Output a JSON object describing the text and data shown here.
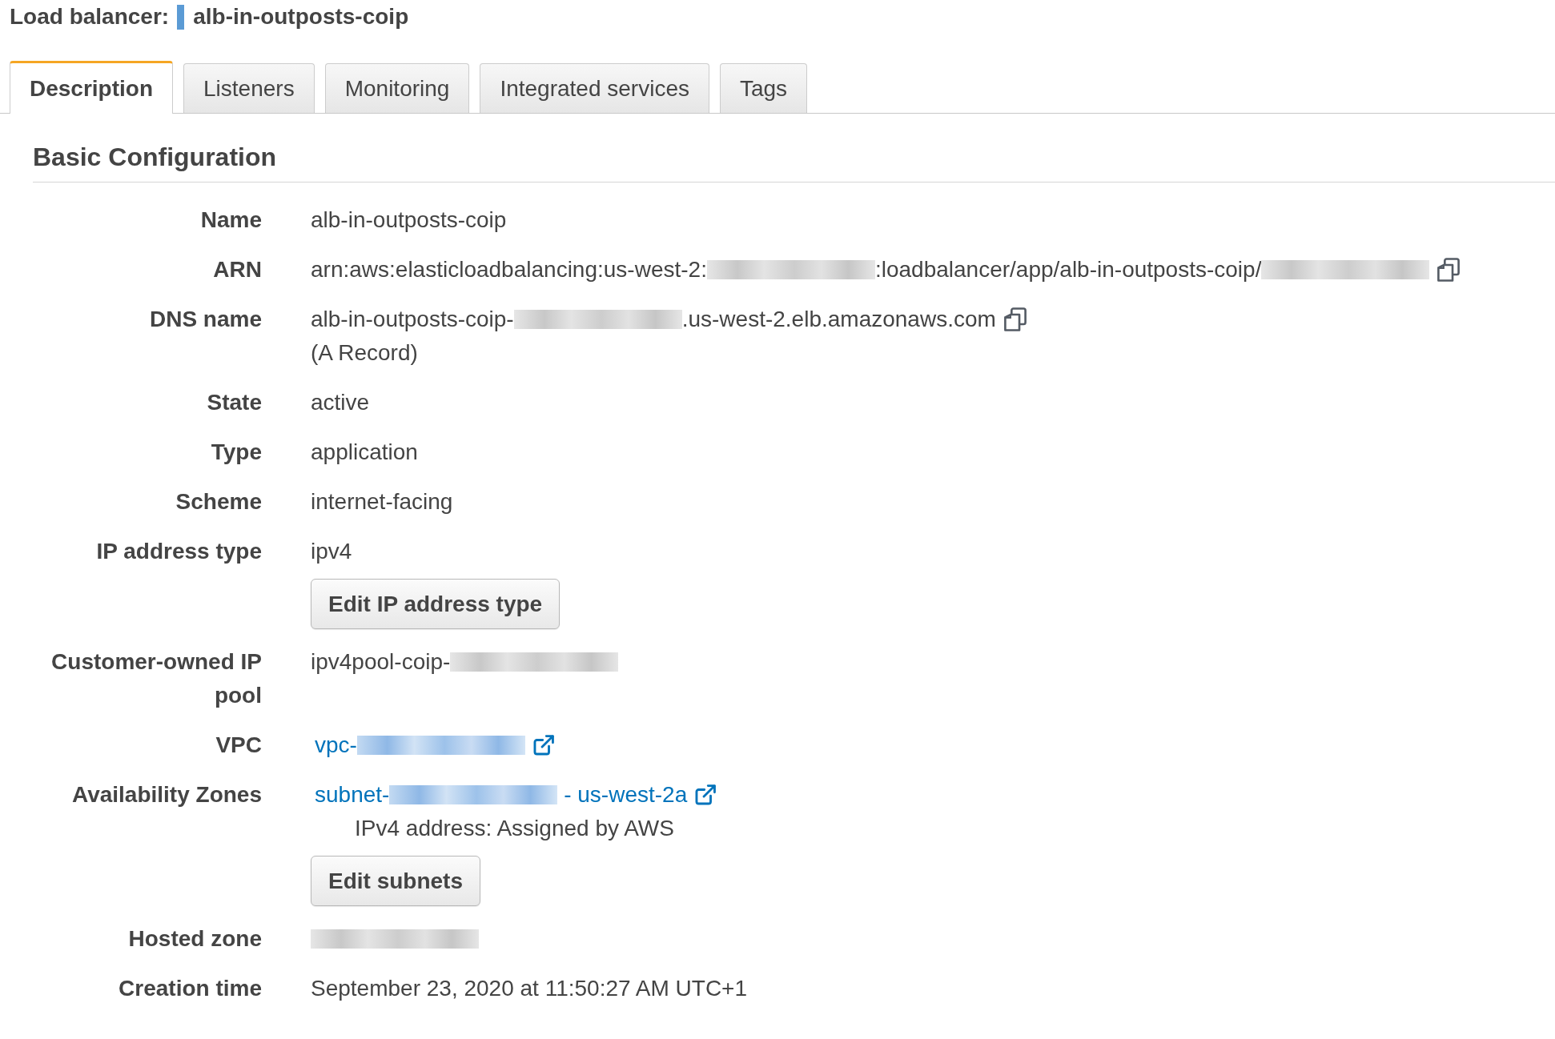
{
  "header": {
    "label": "Load balancer:",
    "name": "alb-in-outposts-coip"
  },
  "tabs": [
    {
      "label": "Description",
      "selected": true
    },
    {
      "label": "Listeners",
      "selected": false
    },
    {
      "label": "Monitoring",
      "selected": false
    },
    {
      "label": "Integrated services",
      "selected": false
    },
    {
      "label": "Tags",
      "selected": false
    }
  ],
  "section": {
    "title": "Basic Configuration",
    "fields": [
      {
        "label": "Name",
        "lines": [
          {
            "kind": "text",
            "parts": [
              {
                "kind": "text",
                "text": "alb-in-outposts-coip"
              }
            ]
          }
        ]
      },
      {
        "label": "ARN",
        "lines": [
          {
            "kind": "text",
            "parts": [
              {
                "kind": "text",
                "text": "arn:aws:elasticloadbalancing:us-west-2:"
              },
              {
                "kind": "redacted"
              },
              {
                "kind": "text",
                "text": ":loadbalancer/app/alb-in-outposts-coip/"
              },
              {
                "kind": "redacted"
              },
              {
                "kind": "copy"
              }
            ]
          }
        ]
      },
      {
        "label": "DNS name",
        "lines": [
          {
            "kind": "text",
            "parts": [
              {
                "kind": "text",
                "text": "alb-in-outposts-coip-"
              },
              {
                "kind": "redacted"
              },
              {
                "kind": "text",
                "text": ".us-west-2.elb.amazonaws.com"
              },
              {
                "kind": "copy"
              }
            ]
          },
          {
            "kind": "text",
            "parts": [
              {
                "kind": "text",
                "text": "(A Record)"
              }
            ]
          }
        ]
      },
      {
        "label": "State",
        "lines": [
          {
            "kind": "text",
            "parts": [
              {
                "kind": "text",
                "text": "active"
              }
            ]
          }
        ]
      },
      {
        "label": "Type",
        "lines": [
          {
            "kind": "text",
            "parts": [
              {
                "kind": "text",
                "text": "application"
              }
            ]
          }
        ]
      },
      {
        "label": "Scheme",
        "lines": [
          {
            "kind": "text",
            "parts": [
              {
                "kind": "text",
                "text": "internet-facing"
              }
            ]
          }
        ]
      },
      {
        "label": "IP address type",
        "lines": [
          {
            "kind": "text",
            "parts": [
              {
                "kind": "text",
                "text": "ipv4"
              }
            ]
          },
          {
            "kind": "button",
            "label": "Edit IP address type"
          }
        ]
      },
      {
        "label": "Customer-owned IP pool",
        "lines": [
          {
            "kind": "text",
            "parts": [
              {
                "kind": "text",
                "text": "ipv4pool-coip-"
              },
              {
                "kind": "redacted"
              }
            ]
          }
        ]
      },
      {
        "label": "VPC",
        "lines": [
          {
            "kind": "link",
            "parts": [
              {
                "kind": "text",
                "text": "vpc-"
              },
              {
                "kind": "redacted"
              },
              {
                "kind": "external"
              }
            ]
          }
        ]
      },
      {
        "label": "Availability Zones",
        "lines": [
          {
            "kind": "link",
            "parts": [
              {
                "kind": "text",
                "text": "subnet-"
              },
              {
                "kind": "redacted"
              },
              {
                "kind": "text",
                "text": " - us-west-2a"
              },
              {
                "kind": "external"
              }
            ]
          },
          {
            "kind": "note",
            "parts": [
              {
                "kind": "text",
                "text": "IPv4 address: Assigned by AWS"
              }
            ]
          },
          {
            "kind": "button",
            "label": "Edit subnets"
          }
        ]
      },
      {
        "label": "Hosted zone",
        "lines": [
          {
            "kind": "text",
            "parts": [
              {
                "kind": "redacted"
              }
            ]
          }
        ]
      },
      {
        "label": "Creation time",
        "lines": [
          {
            "kind": "text",
            "parts": [
              {
                "kind": "text",
                "text": "September 23, 2020 at 11:50:27 AM UTC+1"
              }
            ]
          }
        ]
      }
    ]
  }
}
